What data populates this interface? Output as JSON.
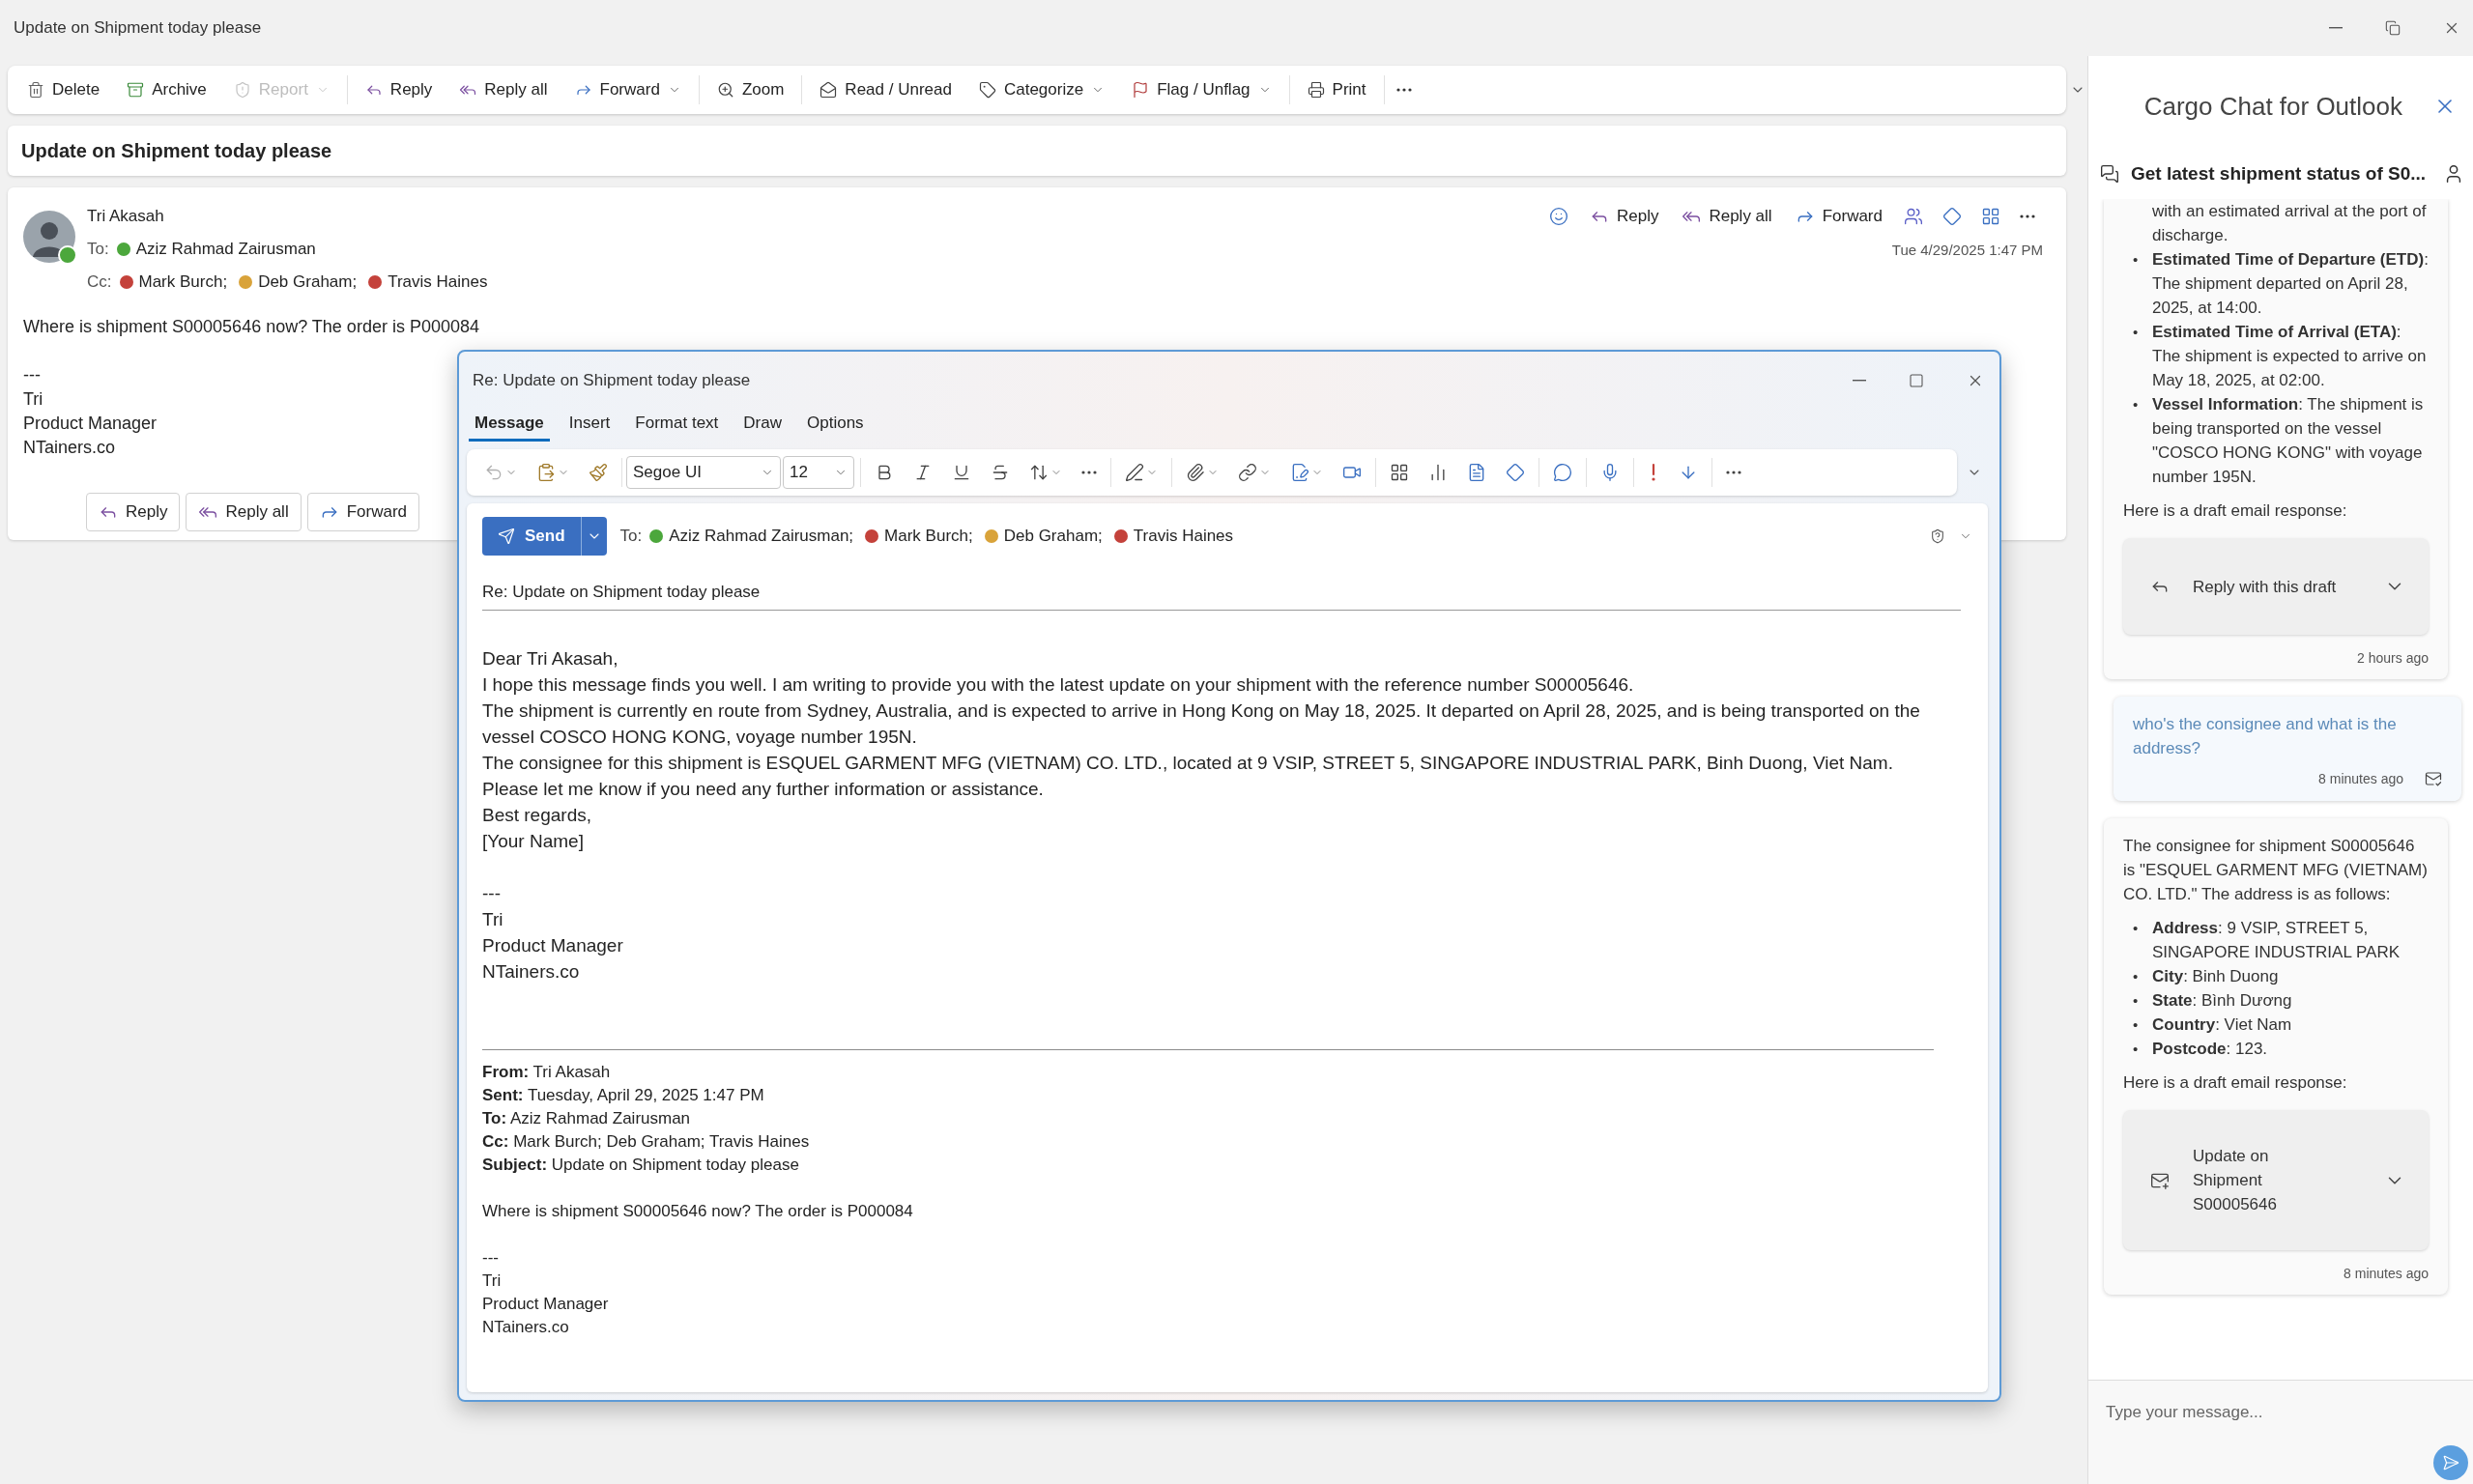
{
  "window": {
    "title": "Update on Shipment today please"
  },
  "toolbar": [
    [
      {
        "label": "Delete",
        "disabled": false,
        "dropdown": false
      },
      {
        "label": "Archive",
        "disabled": false,
        "dropdown": false
      },
      {
        "label": "Report",
        "disabled": true,
        "dropdown": true
      }
    ],
    [
      {
        "label": "Reply",
        "disabled": false,
        "dropdown": false
      },
      {
        "label": "Reply all",
        "disabled": false,
        "dropdown": false
      },
      {
        "label": "Forward",
        "disabled": false,
        "dropdown": true
      }
    ],
    [
      {
        "label": "Zoom",
        "disabled": false,
        "dropdown": false
      }
    ],
    [
      {
        "label": "Read / Unread",
        "disabled": false,
        "dropdown": false
      },
      {
        "label": "Categorize",
        "disabled": false,
        "dropdown": true
      },
      {
        "label": "Flag / Unflag",
        "disabled": false,
        "dropdown": true
      }
    ],
    [
      {
        "label": "Print",
        "disabled": false,
        "dropdown": false
      }
    ]
  ],
  "message": {
    "subject": "Update on Shipment today please",
    "sender": "Tri Akasah",
    "sender_presence": {
      "color": "#4ca73c"
    },
    "to_label": "To:",
    "to": [
      {
        "name": "Aziz Rahmad Zairusman",
        "color": "#4ca73c"
      }
    ],
    "cc_label": "Cc:",
    "cc": [
      {
        "name": "Mark Burch;",
        "color": "#c4423b"
      },
      {
        "name": "Deb Graham;",
        "color": "#d9a33a"
      },
      {
        "name": "Travis Haines",
        "color": "#c4423b"
      }
    ],
    "actions": [
      "Reply",
      "Reply all",
      "Forward"
    ],
    "date": "Tue 4/29/2025 1:47 PM",
    "body": [
      [
        "Where is shipment S00005646 now? The order is P000084"
      ],
      [
        "---",
        "Tri",
        "Product Manager",
        "NTainers.co"
      ]
    ],
    "footer_buttons": [
      "Reply",
      "Reply all",
      "Forward"
    ]
  },
  "compose": {
    "title": "Re: Update on Shipment today please",
    "tabs": [
      {
        "label": "Message",
        "selected": true
      },
      {
        "label": "Insert",
        "selected": false
      },
      {
        "label": "Format text",
        "selected": false
      },
      {
        "label": "Draw",
        "selected": false
      },
      {
        "label": "Options",
        "selected": false
      }
    ],
    "font": "Segoe UI",
    "size": "12",
    "send": "Send",
    "to_label": "To:",
    "to": [
      {
        "name": "Aziz Rahmad Zairusman;",
        "color": "#4ca73c"
      },
      {
        "name": "Mark Burch;",
        "color": "#c4423b"
      },
      {
        "name": "Deb Graham;",
        "color": "#d9a33a"
      },
      {
        "name": "Travis Haines",
        "color": "#c4423b"
      }
    ],
    "subject": "Re: Update on Shipment today please",
    "body": [
      [
        "Dear Tri Akasah,",
        "I hope this message finds you well. I am writing to provide you with the latest update on your shipment with the reference number S00005646.",
        "The shipment is currently en route from Sydney, Australia, and is expected to arrive in Hong Kong on May 18, 2025. It departed on April 28, 2025, and is being transported on the vessel COSCO HONG KONG, voyage number 195N.",
        "The consignee for this shipment is ESQUEL GARMENT MFG (VIETNAM) CO. LTD., located at 9 VSIP, STREET 5, SINGAPORE INDUSTRIAL PARK, Binh Duong, Viet Nam.",
        "Please let me know if you need any further information or assistance.",
        "Best regards,",
        "[Your Name]"
      ],
      [
        "---",
        "Tri",
        "Product Manager",
        "NTainers.co"
      ]
    ],
    "quoted_header": [
      "**From:** Tri Akasah",
      "**Sent:** Tuesday, April 29, 2025 1:47 PM",
      "**To:** Aziz Rahmad Zairusman",
      "**Cc:** Mark Burch; Deb Graham; Travis Haines",
      "**Subject:** Update on Shipment today please"
    ],
    "quoted_body": [
      [
        "Where is shipment S00005646 now? The order is P000084"
      ],
      [
        "---",
        "Tri",
        "Product Manager",
        "NTainers.co"
      ]
    ]
  },
  "chat": {
    "title": "Cargo Chat for Outlook",
    "thread": "Get latest shipment status of S0...",
    "messages": [
      {
        "kind": "bot",
        "bullets": [
          {
            "text": "with an estimated arrival at the port of discharge."
          },
          {
            "marker": "•",
            "text": "**Estimated Time of Departure (ETD)**: The shipment departed on April 28, 2025, at 14:00."
          },
          {
            "marker": "•",
            "text": "**Estimated Time of Arrival (ETA)**: The shipment is expected to arrive on May 18, 2025, at 02:00."
          },
          {
            "marker": "•",
            "text": "**Vessel Information**: The shipment is being transported on the vessel \"COSCO HONG KONG\" with voyage number 195N."
          }
        ],
        "draft_intro": "Here is a draft email response:",
        "draft": {
          "kind": "reply",
          "label": "Reply with this draft"
        },
        "time": "2 hours ago"
      },
      {
        "kind": "user",
        "text": "who's the consignee and what is the address?",
        "time": "8 minutes ago"
      },
      {
        "kind": "bot",
        "intro": "The consignee for shipment S00005646 is \"ESQUEL GARMENT MFG (VIETNAM) CO. LTD.\" The address is as follows:",
        "bullets": [
          {
            "marker": "•",
            "text": "**Address**: 9 VSIP, STREET 5, SINGAPORE INDUSTRIAL PARK"
          },
          {
            "marker": "•",
            "text": "**City**: Binh Duong"
          },
          {
            "marker": "•",
            "text": "**State**: Bình Dương"
          },
          {
            "marker": "•",
            "text": "**Country**: Viet Nam"
          },
          {
            "marker": "•",
            "text": "**Postcode**: 123."
          }
        ],
        "draft_intro": "Here is a draft email response:",
        "draft": {
          "kind": "new",
          "label": "Update on Shipment S00005646"
        },
        "time": "8 minutes ago"
      }
    ],
    "input": {
      "placeholder": "Type your message..."
    }
  }
}
